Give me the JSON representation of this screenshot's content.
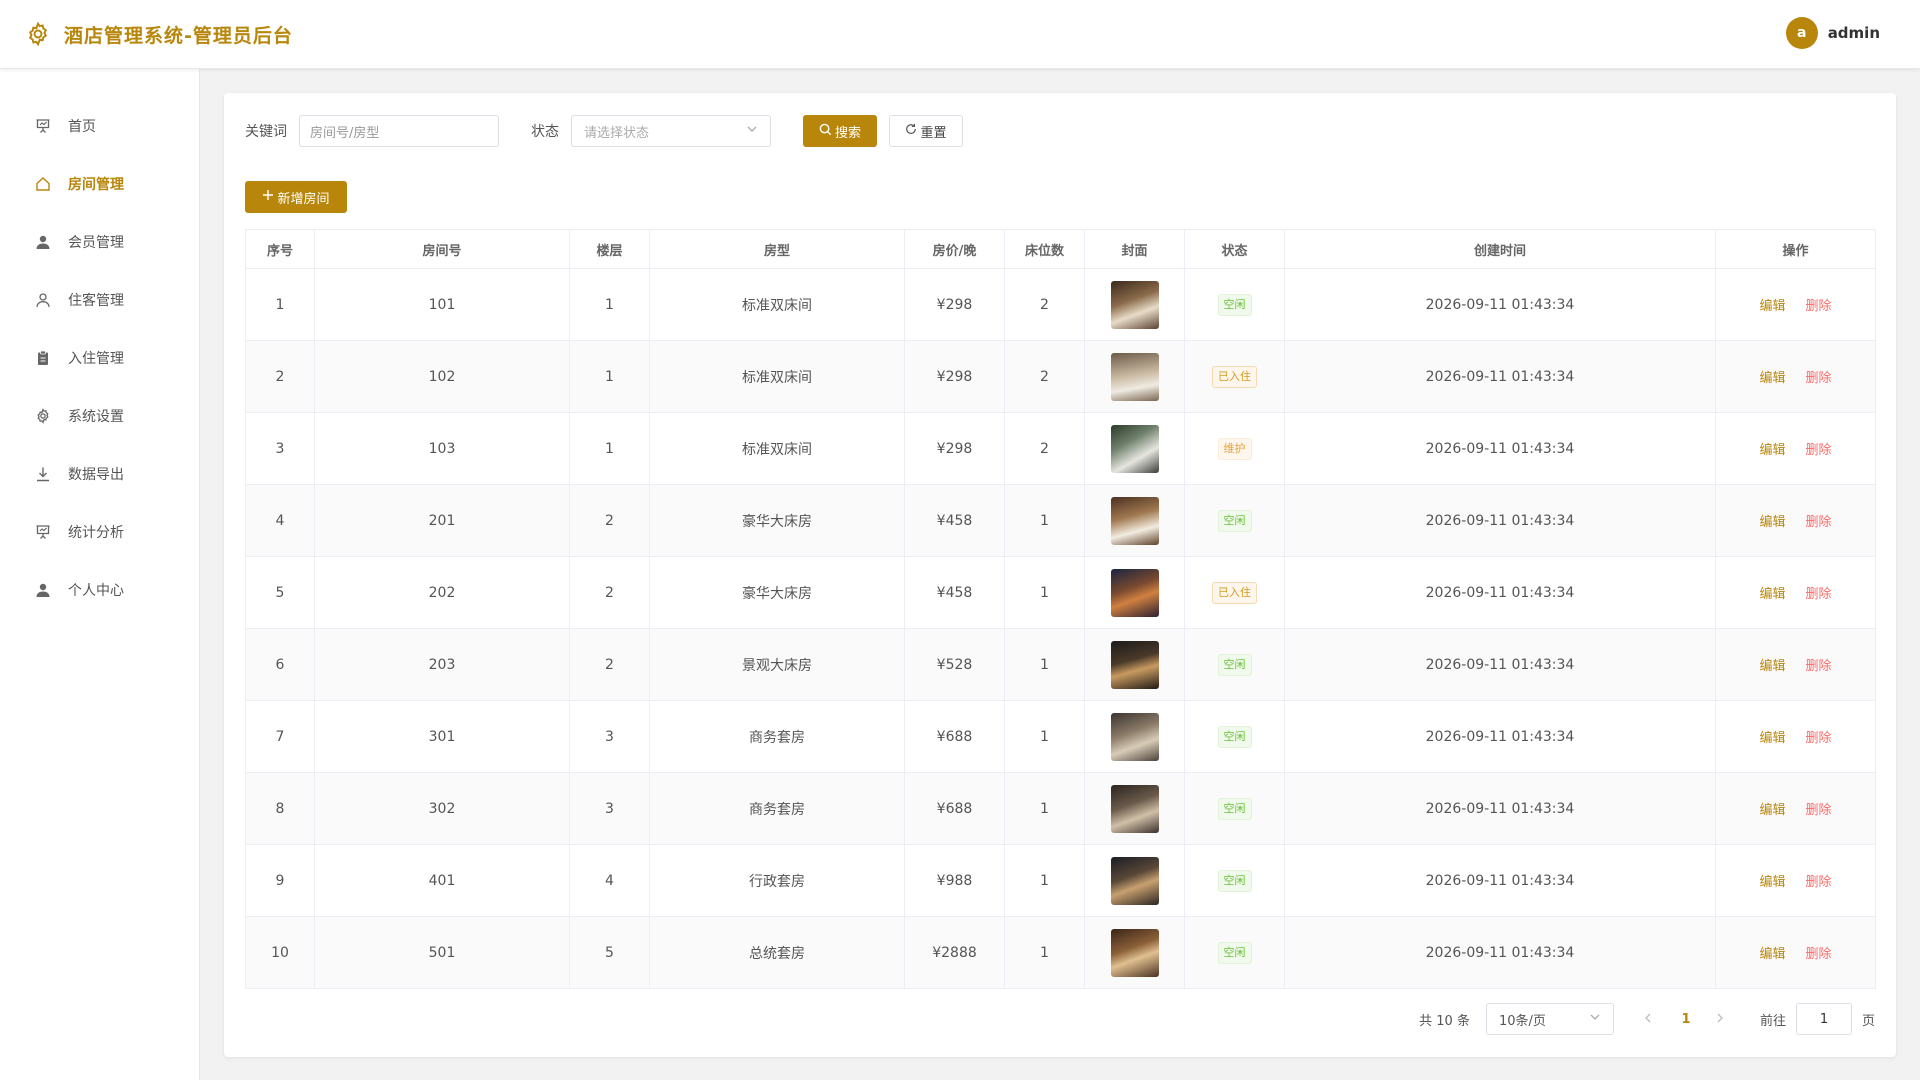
{
  "header": {
    "title": "酒店管理系统-管理员后台",
    "brand_icon": "gear-icon",
    "avatar_letter": "a",
    "username": "admin",
    "accent": "#b8860b"
  },
  "sidebar": {
    "items": [
      {
        "label": "首页",
        "icon": "presentation-icon",
        "active": false
      },
      {
        "label": "房间管理",
        "icon": "house-icon",
        "active": true
      },
      {
        "label": "会员管理",
        "icon": "user-filled-icon",
        "active": false
      },
      {
        "label": "住客管理",
        "icon": "user-outline-icon",
        "active": false
      },
      {
        "label": "入住管理",
        "icon": "clipboard-icon",
        "active": false
      },
      {
        "label": "系统设置",
        "icon": "gear-icon",
        "active": false
      },
      {
        "label": "数据导出",
        "icon": "download-icon",
        "active": false
      },
      {
        "label": "统计分析",
        "icon": "presentation-icon",
        "active": false
      },
      {
        "label": "个人中心",
        "icon": "user-filled-icon",
        "active": false
      }
    ]
  },
  "filters": {
    "keyword_label": "关键词",
    "keyword_placeholder": "房间号/房型",
    "status_label": "状态",
    "status_placeholder": "请选择状态",
    "search_label": "搜索",
    "reset_label": "重置"
  },
  "add_button_label": "新增房间",
  "table": {
    "columns": [
      "序号",
      "房间号",
      "楼层",
      "房型",
      "房价/晚",
      "床位数",
      "封面",
      "状态",
      "创建时间",
      "操作"
    ],
    "edit_label": "编辑",
    "delete_label": "删除",
    "rows": [
      {
        "no": "1",
        "room": "101",
        "floor": "1",
        "type": "标准双床间",
        "price": "¥298",
        "beds": "2",
        "status": "空闲",
        "status_kind": "free",
        "created": "2026-09-11 01:43:34"
      },
      {
        "no": "2",
        "room": "102",
        "floor": "1",
        "type": "标准双床间",
        "price": "¥298",
        "beds": "2",
        "status": "已入住",
        "status_kind": "occ",
        "created": "2026-09-11 01:43:34"
      },
      {
        "no": "3",
        "room": "103",
        "floor": "1",
        "type": "标准双床间",
        "price": "¥298",
        "beds": "2",
        "status": "维护",
        "status_kind": "maint",
        "created": "2026-09-11 01:43:34"
      },
      {
        "no": "4",
        "room": "201",
        "floor": "2",
        "type": "豪华大床房",
        "price": "¥458",
        "beds": "1",
        "status": "空闲",
        "status_kind": "free",
        "created": "2026-09-11 01:43:34"
      },
      {
        "no": "5",
        "room": "202",
        "floor": "2",
        "type": "豪华大床房",
        "price": "¥458",
        "beds": "1",
        "status": "已入住",
        "status_kind": "occ",
        "created": "2026-09-11 01:43:34"
      },
      {
        "no": "6",
        "room": "203",
        "floor": "2",
        "type": "景观大床房",
        "price": "¥528",
        "beds": "1",
        "status": "空闲",
        "status_kind": "free",
        "created": "2026-09-11 01:43:34"
      },
      {
        "no": "7",
        "room": "301",
        "floor": "3",
        "type": "商务套房",
        "price": "¥688",
        "beds": "1",
        "status": "空闲",
        "status_kind": "free",
        "created": "2026-09-11 01:43:34"
      },
      {
        "no": "8",
        "room": "302",
        "floor": "3",
        "type": "商务套房",
        "price": "¥688",
        "beds": "1",
        "status": "空闲",
        "status_kind": "free",
        "created": "2026-09-11 01:43:34"
      },
      {
        "no": "9",
        "room": "401",
        "floor": "4",
        "type": "行政套房",
        "price": "¥988",
        "beds": "1",
        "status": "空闲",
        "status_kind": "free",
        "created": "2026-09-11 01:43:34"
      },
      {
        "no": "10",
        "room": "501",
        "floor": "5",
        "type": "总统套房",
        "price": "¥2888",
        "beds": "1",
        "status": "空闲",
        "status_kind": "free",
        "created": "2026-09-11 01:43:34"
      }
    ]
  },
  "pagination": {
    "total_text": "共 10 条",
    "page_size": "10条/页",
    "current_page": "1",
    "goto_label": "前往",
    "goto_value": "1",
    "page_suffix": "页"
  }
}
